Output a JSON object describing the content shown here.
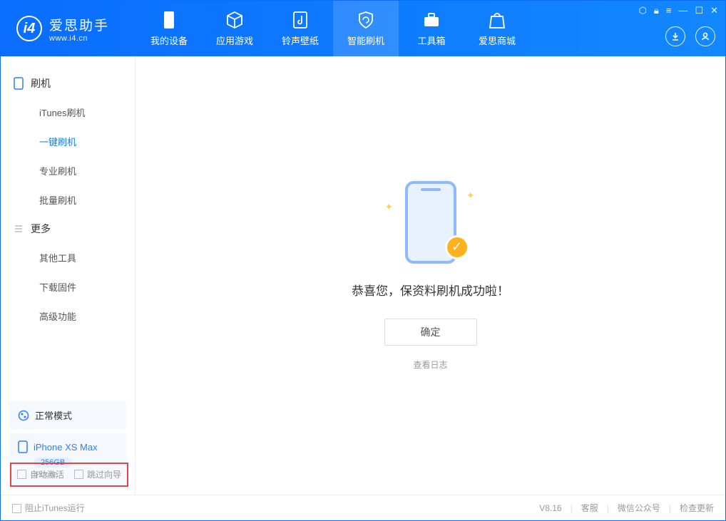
{
  "app": {
    "name": "爱思助手",
    "url": "www.i4.cn"
  },
  "nav": {
    "tabs": [
      {
        "label": "我的设备"
      },
      {
        "label": "应用游戏"
      },
      {
        "label": "铃声壁纸"
      },
      {
        "label": "智能刷机"
      },
      {
        "label": "工具箱"
      },
      {
        "label": "爱思商城"
      }
    ]
  },
  "sidebar": {
    "group1": {
      "title": "刷机",
      "items": [
        "iTunes刷机",
        "一键刷机",
        "专业刷机",
        "批量刷机"
      ]
    },
    "group2": {
      "title": "更多",
      "items": [
        "其他工具",
        "下载固件",
        "高级功能"
      ]
    },
    "status": "正常模式",
    "device": {
      "name": "iPhone XS Max",
      "capacity": "256GB",
      "type": "iPhone"
    }
  },
  "main": {
    "success_text": "恭喜您，保资料刷机成功啦！",
    "ok_label": "确定",
    "log_link": "查看日志"
  },
  "options": {
    "auto_activate": "自动激活",
    "skip_guide": "跳过向导"
  },
  "footer": {
    "block_itunes": "阻止iTunes运行",
    "version": "V8.16",
    "support": "客服",
    "wechat": "微信公众号",
    "update": "检查更新"
  }
}
